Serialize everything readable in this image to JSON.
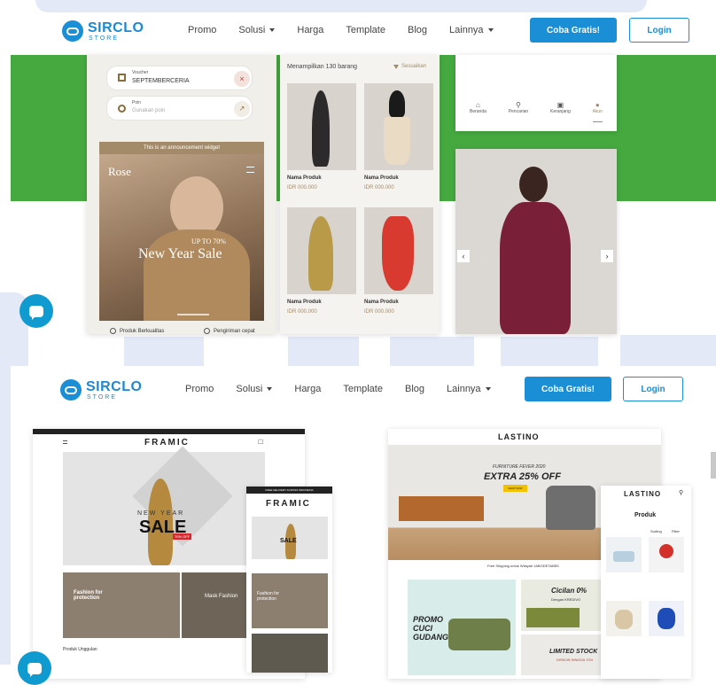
{
  "nav": {
    "logo_main": "SIRCLO",
    "logo_sub": "STORE",
    "links": [
      "Promo",
      "Solusi",
      "Harga",
      "Template",
      "Blog",
      "Lainnya"
    ],
    "cta": "Coba Gratis!",
    "login": "Login"
  },
  "top_mockup": {
    "voucher_label": "Voucher",
    "voucher_code": "SEPTEMBERCERIA",
    "poin_label": "Poin",
    "poin_placeholder": "Gunakan poin",
    "announcement": "This is an announcement widget",
    "brand": "Rose",
    "sale_up": "UP TO 70%",
    "sale_title": "New Year Sale",
    "feature1": "Produk Berkualitas",
    "feature2": "Pengiriman cepat",
    "showing": "Menampilkan 130 barang",
    "filter": "Sesuaikan",
    "product_name": "Nama Produk",
    "product_price": "IDR 000.000",
    "bottom_nav": [
      "Beranda",
      "Pencarian",
      "Keranjang",
      "Akun"
    ]
  },
  "framic": {
    "banner": "FREE DELIVERY ACROSS INDONESIA",
    "brand": "FRAMIC",
    "new_year": "NEW YEAR",
    "sale": "SALE",
    "badge": "70% OFF",
    "tile1": "Fashion for protection",
    "tile2": "Mask Fashion",
    "featured": "Produk Unggulan"
  },
  "lastino": {
    "brand": "LASTINO",
    "hero_small": "FURNITURE FEVER 2020",
    "hero_big": "EXTRA 25% OFF",
    "hero_btn": "SHOP NOW",
    "shipping": "Free Shipping untuk Wilayah JABODETABEK",
    "promo": "PROMO CUCI GUDANG",
    "cicilan": "Cicilan 0%",
    "cicilan_sub": "Dengan KREDIVO",
    "limited": "LIMITED STOCK",
    "limited_sub": "DISKON HINGGA 70%",
    "mobile_title": "Produk",
    "sort": "Sorting",
    "filter": "Filter"
  },
  "colors": {
    "primary": "#1a8fd6",
    "green": "#45a940",
    "watermark": "#e3e9f7"
  }
}
